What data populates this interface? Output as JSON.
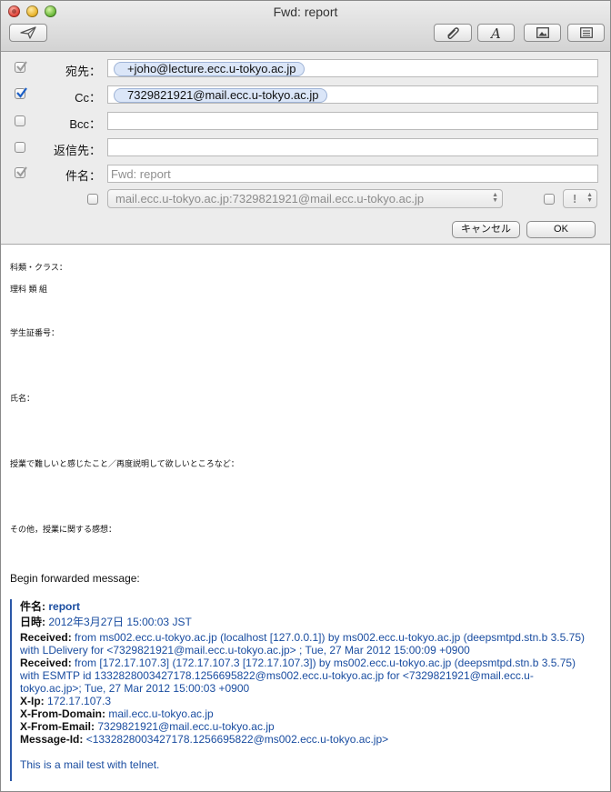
{
  "window": {
    "title": "Fwd: report"
  },
  "toolbar": {
    "send": "send-icon",
    "attach": "paperclip-icon",
    "fonts": "fonts-icon",
    "photo": "photo-browser-icon",
    "header_options": "header-options-icon"
  },
  "header": {
    "to_label": "宛先：",
    "to_value": "+joho@lecture.ecc.u-tokyo.ac.jp",
    "cc_label": "Cc：",
    "cc_value": "7329821921@mail.ecc.u-tokyo.ac.jp",
    "bcc_label": "Bcc：",
    "replyto_label": "返信先：",
    "subject_label": "件名：",
    "subject_placeholder": "Fwd: report",
    "from_account": "mail.ecc.u-tokyo.ac.jp:7329821921@mail.ecc.u-tokyo.ac.jp",
    "priority": "!",
    "cancel_label": "キャンセル",
    "ok_label": "OK",
    "checks": {
      "to": true,
      "cc": true,
      "bcc": false,
      "replyto": false,
      "subject": true,
      "account": false,
      "priority": false
    }
  },
  "body": {
    "lines": [
      "科類・クラス：",
      "理科  類  組",
      "学生証番号：",
      "氏名：",
      "授業で難しいと感じたこと／再度説明して欲しいところなど：",
      "その他，授業に関する感想："
    ],
    "forward_intro": "Begin forwarded message:",
    "forwarded": {
      "subject_label": "件名:",
      "subject_value": "report",
      "date_label": "日時:",
      "date_value": "2012年3月27日 15:00:03 JST",
      "received1_label": "Received:",
      "received1_value_a": "from ms002.ecc.u-tokyo.ac.jp (localhost [127.0.0.1]) by ms002.ecc.u-tokyo.ac.jp (deepsmtpd.stn.b 3.5.75)",
      "received1_value_b": "with LDelivery for <7329821921@mail.ecc.u-tokyo.ac.jp> ; Tue, 27 Mar 2012 15:00:09 +0900",
      "received2_label": "Received:",
      "received2_value_a": "from [172.17.107.3] (172.17.107.3 [172.17.107.3]) by ms002.ecc.u-tokyo.ac.jp (deepsmtpd.stn.b 3.5.75)",
      "received2_value_b": "with ESMTP id 1332828003427178.1256695822@ms002.ecc.u-tokyo.ac.jp for <7329821921@mail.ecc.u-",
      "received2_value_c": "tokyo.ac.jp>; Tue, 27 Mar 2012 15:00:03 +0900",
      "xip_label": "X-Ip:",
      "xip_value": "172.17.107.3",
      "xfromdomain_label": "X-From-Domain:",
      "xfromdomain_value": "mail.ecc.u-tokyo.ac.jp",
      "xfromemail_label": "X-From-Email:",
      "xfromemail_value": "7329821921@mail.ecc.u-tokyo.ac.jp",
      "messageid_label": "Message-Id:",
      "messageid_value": "<1332828003427178.1256695822@ms002.ecc.u-tokyo.ac.jp>",
      "body_text": "This is a mail test with telnet."
    }
  }
}
